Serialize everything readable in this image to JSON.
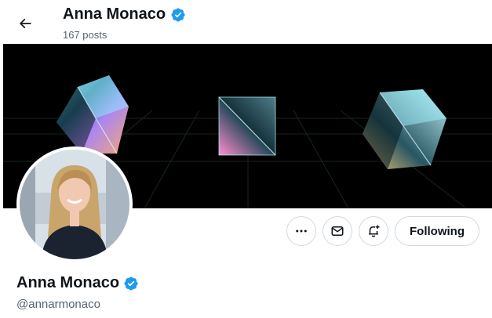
{
  "header": {
    "name": "Anna Monaco",
    "posts": "167 posts"
  },
  "profile": {
    "name": "Anna Monaco",
    "handle": "@annarmonaco",
    "verified": true
  },
  "actions": {
    "more_icon": "more-horizontal-icon",
    "message_icon": "envelope-icon",
    "notify_icon": "bell-plus-icon",
    "follow_label": "Following"
  },
  "colors": {
    "verified_blue": "#1d9bf0",
    "text_primary": "#0f1419",
    "text_secondary": "#536471",
    "border": "#cfd9de",
    "banner_bg": "#000000"
  }
}
